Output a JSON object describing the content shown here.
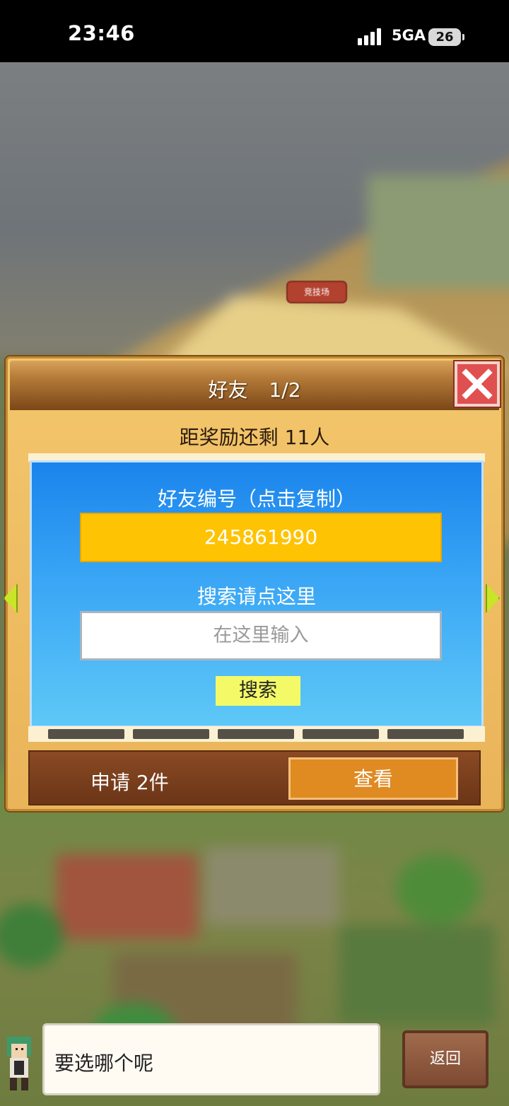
{
  "status_bar": {
    "time": "23:46",
    "network": "5GA",
    "battery": "26"
  },
  "background": {
    "arena_sign": "竞技场"
  },
  "dialog": {
    "title": "好友",
    "page": "1/2",
    "reward_text": "距奖励还剩 11人",
    "friend_id_label": "好友编号（点击复制）",
    "friend_id": "245861990",
    "search_hint": "搜索请点这里",
    "search_placeholder": "在这里输入",
    "search_button": "搜索",
    "request_label": "申请 2件",
    "view_button": "查看"
  },
  "footer": {
    "message": "要选哪个呢",
    "back_button": "返回"
  },
  "colors": {
    "panel_blue": "#1a84ec",
    "friend_id_bg": "#fec303",
    "close_red": "#e05050",
    "view_orange": "#e08a22",
    "search_yellow": "#f4fa67"
  },
  "icons": [
    "signal-icon",
    "battery-icon",
    "close-icon",
    "arrow-left-icon",
    "arrow-right-icon",
    "npc-avatar"
  ]
}
